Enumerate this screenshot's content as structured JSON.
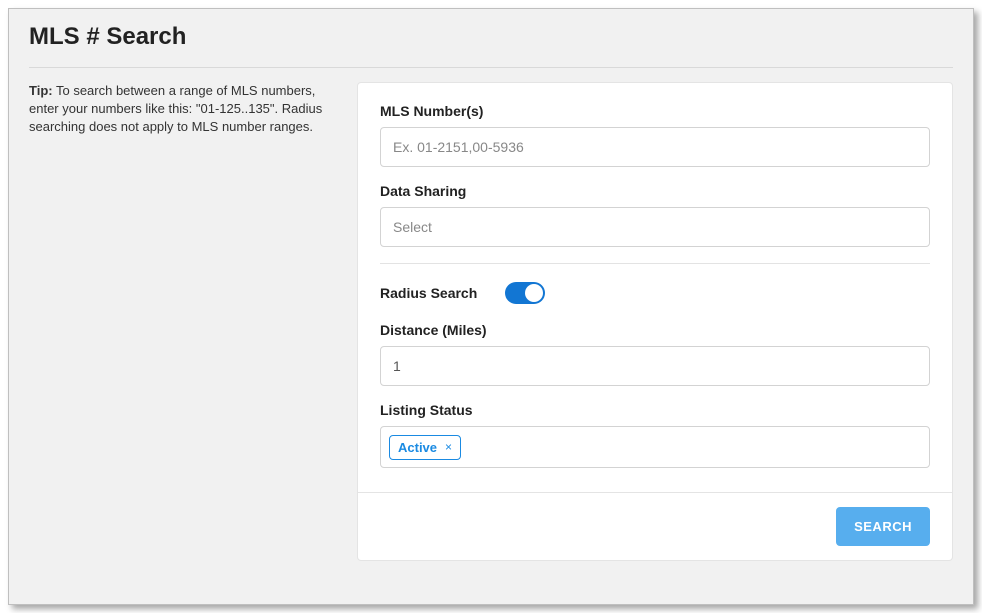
{
  "page": {
    "title": "MLS # Search"
  },
  "tip": {
    "label": "Tip:",
    "text": "To search between a range of MLS numbers, enter your numbers like this: \"01-125..135\". Radius searching does not apply to MLS number ranges."
  },
  "form": {
    "mls_number": {
      "label": "MLS Number(s)",
      "placeholder": "Ex. 01-2151,00-5936",
      "value": ""
    },
    "data_sharing": {
      "label": "Data Sharing",
      "selected": "Select"
    },
    "radius": {
      "label": "Radius Search",
      "enabled": true
    },
    "distance": {
      "label": "Distance (Miles)",
      "value": "1"
    },
    "listing_status": {
      "label": "Listing Status",
      "tags": [
        {
          "label": "Active"
        }
      ]
    }
  },
  "actions": {
    "search": "SEARCH"
  }
}
